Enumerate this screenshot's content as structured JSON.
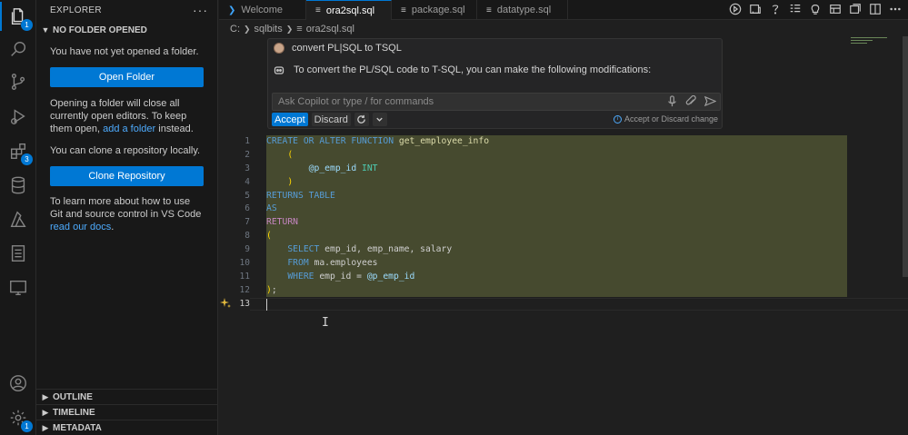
{
  "activity_bar": {
    "explorer_badge": "1",
    "extensions_badge": "3",
    "settings_badge": "1"
  },
  "sidebar": {
    "header": "EXPLORER",
    "more": "···",
    "section_title": "NO FOLDER OPENED",
    "msg1": "You have not yet opened a folder.",
    "open_folder_btn": "Open Folder",
    "msg2_a": "Opening a folder will close all currently open editors. To keep them open, ",
    "msg2_link": "add a folder",
    "msg2_b": " instead.",
    "msg3": "You can clone a repository locally.",
    "clone_btn": "Clone Repository",
    "msg4_a": "To learn more about how to use Git and source control in VS Code ",
    "msg4_link": "read our docs",
    "msg4_b": ".",
    "bottom_sections": [
      "OUTLINE",
      "TIMELINE",
      "METADATA"
    ]
  },
  "tabs": [
    {
      "label": "Welcome",
      "active": false,
      "dirty": false
    },
    {
      "label": "ora2sql.sql",
      "active": true,
      "dirty": true
    },
    {
      "label": "package.sql",
      "active": false,
      "dirty": true
    },
    {
      "label": "datatype.sql",
      "active": false,
      "dirty": true
    }
  ],
  "breadcrumb": [
    "C:",
    "sqlbits",
    "ora2sql.sql"
  ],
  "copilot": {
    "prompt": "convert PL|SQL to TSQL",
    "response": "To convert the PL/SQL code to T-SQL, you can make the following modifications:",
    "input_placeholder": "Ask Copilot or type / for commands",
    "accept_label": "Accept",
    "discard_label": "Discard",
    "hint": "Accept or Discard change"
  },
  "editor": {
    "line_numbers": [
      "1",
      "2",
      "3",
      "4",
      "5",
      "6",
      "7",
      "8",
      "9",
      "10",
      "11",
      "12",
      "13"
    ],
    "code_lines": [
      "CREATE OR ALTER FUNCTION get_employee_info",
      "    (",
      "        @p_emp_id INT",
      "    )",
      "RETURNS TABLE",
      "AS",
      "RETURN",
      "(",
      "    SELECT emp_id, emp_name, salary",
      "    FROM ma.employees",
      "    WHERE emp_id = @p_emp_id",
      ");",
      ""
    ]
  },
  "colors": {
    "accent": "#0078d4",
    "diff_highlight": "#4d5232",
    "keyword": "#569cd6"
  }
}
